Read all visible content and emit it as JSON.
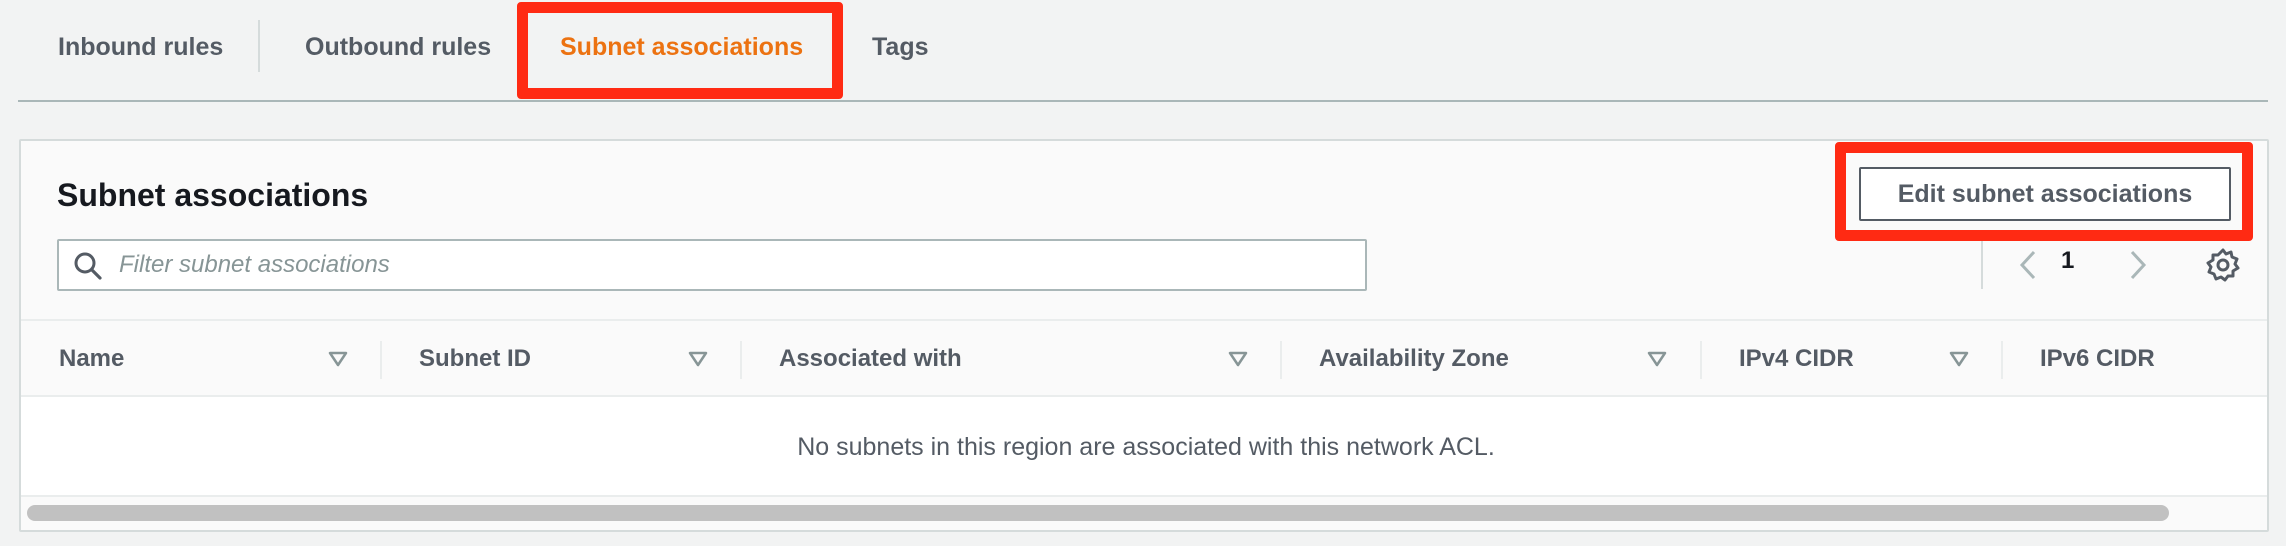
{
  "tabs": [
    {
      "label": "Inbound rules",
      "active": false
    },
    {
      "label": "Outbound rules",
      "active": false
    },
    {
      "label": "Subnet associations",
      "active": true
    },
    {
      "label": "Tags",
      "active": false
    }
  ],
  "panel": {
    "title": "Subnet associations",
    "edit_button_label": "Edit subnet associations"
  },
  "search": {
    "placeholder": "Filter subnet associations",
    "value": ""
  },
  "pagination": {
    "current_page": "1"
  },
  "table": {
    "columns": [
      {
        "label": "Name"
      },
      {
        "label": "Subnet ID"
      },
      {
        "label": "Associated with"
      },
      {
        "label": "Availability Zone"
      },
      {
        "label": "IPv4 CIDR"
      },
      {
        "label": "IPv6 CIDR"
      }
    ],
    "rows": [],
    "empty_message": "No subnets in this region are associated with this network ACL."
  },
  "colors": {
    "active_tab": "#ec7211",
    "highlight": "#ff2a13",
    "text_secondary": "#545b64"
  },
  "icons": [
    "search-icon",
    "chevron-left-icon",
    "chevron-right-icon",
    "gear-icon",
    "sort-caret-icon"
  ]
}
